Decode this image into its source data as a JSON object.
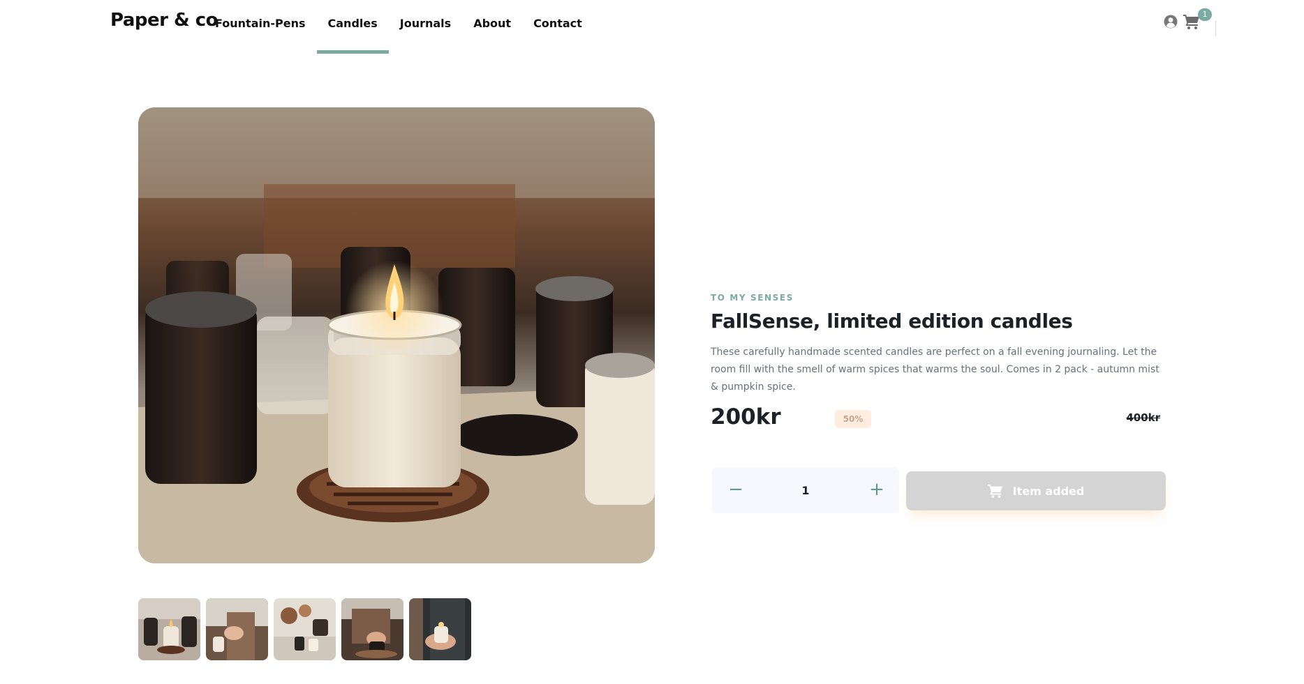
{
  "brand": {
    "logo": "Paper & co"
  },
  "nav": {
    "items": [
      {
        "label": "Fountain-Pens"
      },
      {
        "label": "Candles"
      },
      {
        "label": "Journals"
      },
      {
        "label": "About"
      },
      {
        "label": "Contact"
      }
    ],
    "active": "Candles"
  },
  "header_icons": {
    "user": "user-icon",
    "cart": "cart-icon",
    "cart_count": "1"
  },
  "gallery": {
    "main_image": "candle-jar-photo",
    "thumbnails": [
      "candle-thumb-1",
      "candle-thumb-2",
      "candle-thumb-3",
      "candle-thumb-4",
      "candle-thumb-5"
    ]
  },
  "product": {
    "company": "TO MY SENSES",
    "title": "FallSense, limited edition candles",
    "description": "These carefully handmade scented candles are perfect on a fall evening journaling. Let the room fill with the smell of warm spices that warms the soul. Comes in 2 pack - autumn mist & pumpkin spice.",
    "price": "200kr",
    "discount": "50%",
    "old_price": "400kr"
  },
  "cart_controls": {
    "quantity": "1",
    "minus_symbol": "−",
    "plus_symbol": "+",
    "button_label": "Item added"
  },
  "colors": {
    "accent": "#7aaaa0",
    "discount_bg": "#ffede0",
    "button_disabled": "#d4d4d4",
    "qty_bg": "#f6f8fd"
  }
}
